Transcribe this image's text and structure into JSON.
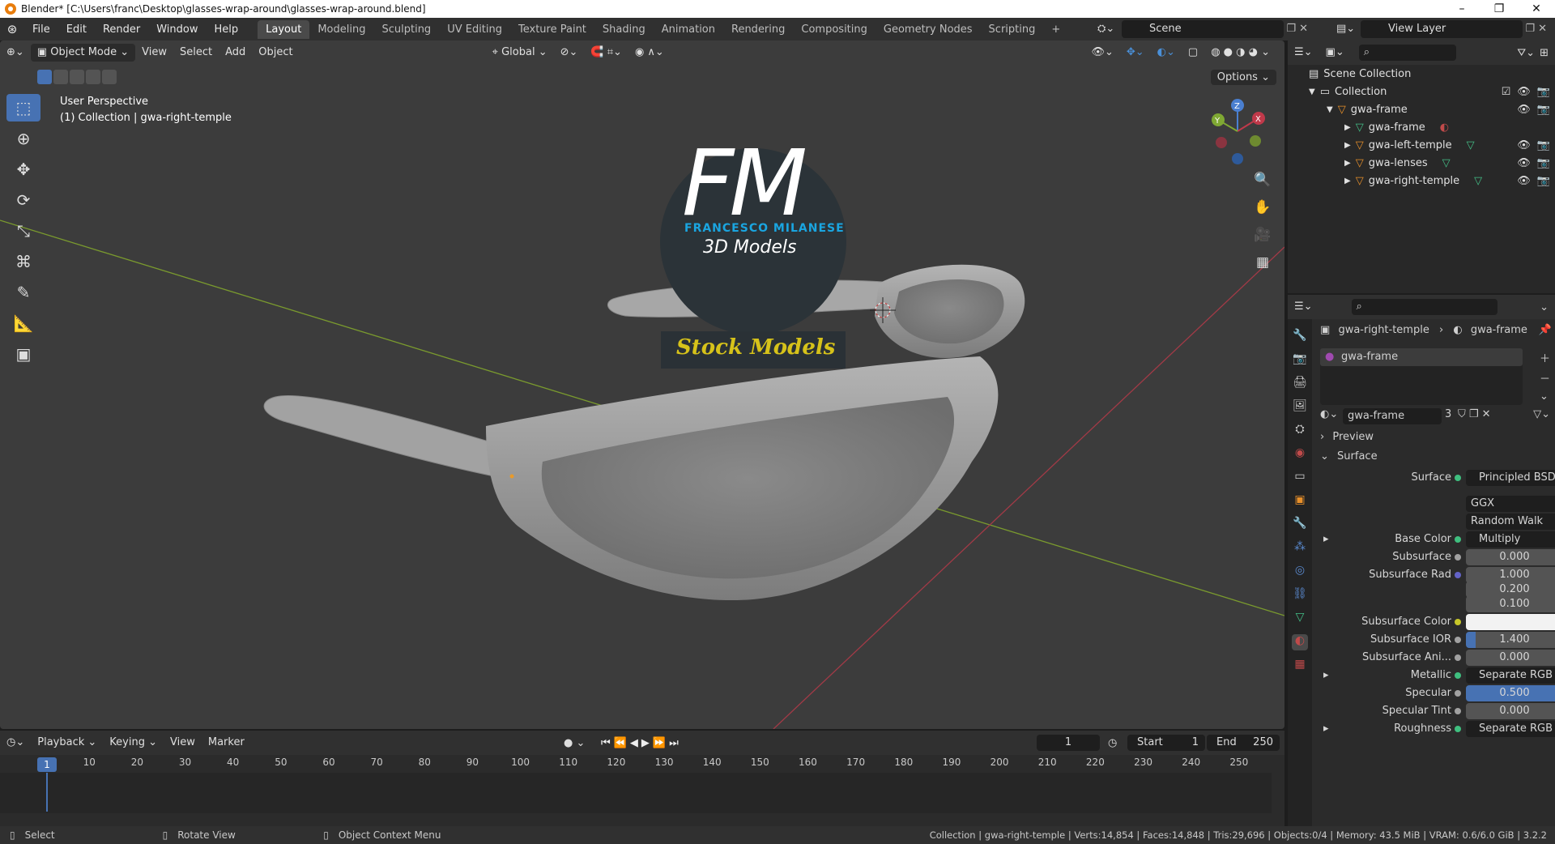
{
  "window": {
    "title": "Blender* [C:\\Users\\franc\\Desktop\\glasses-wrap-around\\glasses-wrap-around.blend]",
    "controls": [
      "–",
      "❐",
      "✕"
    ]
  },
  "menu": [
    "File",
    "Edit",
    "Render",
    "Window",
    "Help"
  ],
  "workspaces": [
    "Layout",
    "Modeling",
    "Sculpting",
    "UV Editing",
    "Texture Paint",
    "Shading",
    "Animation",
    "Rendering",
    "Compositing",
    "Geometry Nodes",
    "Scripting",
    "+"
  ],
  "active_workspace": "Layout",
  "scene": "Scene",
  "view_layer": "View Layer",
  "viewport": {
    "mode": "Object Mode",
    "menus": [
      "View",
      "Select",
      "Add",
      "Object"
    ],
    "transform": "Global",
    "options": "Options",
    "perspective": "User Perspective",
    "collection_label": "(1) Collection | gwa-right-temple",
    "watermark": {
      "letters": "FM",
      "author": "FRANCESCO MILANESE",
      "subtitle": "3D Models",
      "banner": "Stock Models"
    },
    "gizmo_axes": [
      "X",
      "Y",
      "Z"
    ]
  },
  "outliner": {
    "root": "Scene Collection",
    "collection": "Collection",
    "items": [
      {
        "name": "gwa-frame",
        "depth": 1
      },
      {
        "name": "gwa-frame",
        "depth": 2
      },
      {
        "name": "gwa-left-temple",
        "depth": 2
      },
      {
        "name": "gwa-lenses",
        "depth": 2
      },
      {
        "name": "gwa-right-temple",
        "depth": 2
      }
    ]
  },
  "properties": {
    "breadcrumb_object": "gwa-right-temple",
    "breadcrumb_material": "gwa-frame",
    "slot": "gwa-frame",
    "material_name": "gwa-frame",
    "material_users": "3",
    "sections": {
      "preview": "Preview",
      "surface": "Surface"
    },
    "rows": [
      {
        "label": "Surface",
        "value": "Principled BSDF",
        "kind": "link"
      },
      {
        "label": "",
        "value": "GGX",
        "kind": "dropdown"
      },
      {
        "label": "",
        "value": "Random Walk",
        "kind": "dropdown"
      },
      {
        "label": "Base Color",
        "value": "Multiply",
        "kind": "link"
      },
      {
        "label": "Subsurface",
        "value": "0.000",
        "kind": "number"
      },
      {
        "label": "Subsurface Rad",
        "value": "1.000",
        "kind": "number"
      },
      {
        "label": "",
        "value": "0.200",
        "kind": "number"
      },
      {
        "label": "",
        "value": "0.100",
        "kind": "number"
      },
      {
        "label": "Subsurface Color",
        "value": "",
        "kind": "color"
      },
      {
        "label": "Subsurface IOR",
        "value": "1.400",
        "kind": "number"
      },
      {
        "label": "Subsurface Ani...",
        "value": "0.000",
        "kind": "number"
      },
      {
        "label": "Metallic",
        "value": "Separate RGB",
        "kind": "link"
      },
      {
        "label": "Specular",
        "value": "0.500",
        "kind": "number"
      },
      {
        "label": "Specular Tint",
        "value": "0.000",
        "kind": "number"
      },
      {
        "label": "Roughness",
        "value": "Separate RGB",
        "kind": "link"
      }
    ]
  },
  "timeline": {
    "menus": [
      "Playback",
      "Keying",
      "View",
      "Marker"
    ],
    "current_frame": "1",
    "start_label": "Start",
    "start": "1",
    "end_label": "End",
    "end": "250",
    "ruler": [
      "1",
      "10",
      "20",
      "30",
      "40",
      "50",
      "60",
      "70",
      "80",
      "90",
      "100",
      "110",
      "120",
      "130",
      "140",
      "150",
      "160",
      "170",
      "180",
      "190",
      "200",
      "210",
      "220",
      "230",
      "240",
      "250"
    ]
  },
  "status": {
    "hints": [
      "Select",
      "Rotate View",
      "Object Context Menu"
    ],
    "stats": "Collection | gwa-right-temple | Verts:14,854 | Faces:14,848 | Tris:29,696 | Objects:0/4 | Memory: 43.5 MiB | VRAM: 0.6/6.0 GiB | 3.2.2"
  },
  "colors": {
    "accent": "#4772b3",
    "x_axis": "#a33a47",
    "y_axis": "#7a9a2e",
    "watermark_blue": "#1aa5e0",
    "banner_yellow": "#d6c21a"
  }
}
